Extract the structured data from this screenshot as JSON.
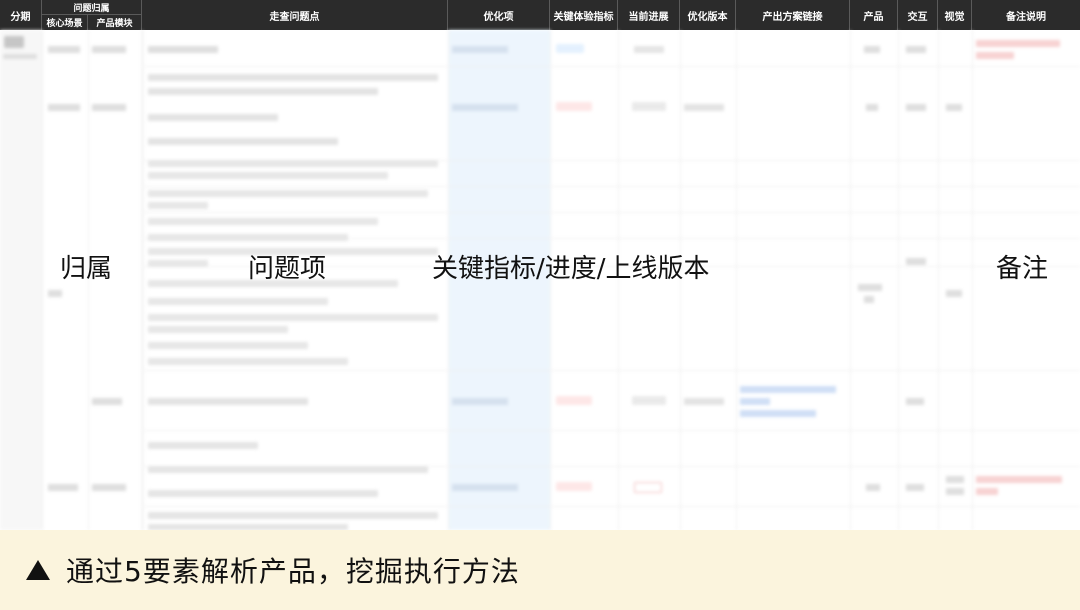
{
  "header": {
    "period": "分期",
    "group": "问题归属",
    "core_scene": "核心场景",
    "product_module": "产品模块",
    "issue_point": "走查问题点",
    "optimization": "优化项",
    "key_metric": "关键体验指标",
    "progress": "当前进展",
    "version": "优化版本",
    "solution_link": "产出方案链接",
    "product": "产品",
    "interaction": "交互",
    "visual": "视觉",
    "remarks": "备注说明"
  },
  "overlay": {
    "ownership": "归属",
    "issue_item": "问题项",
    "metrics": "关键指标/进度/上线版本",
    "remarks": "备注"
  },
  "caption": {
    "text": "通过5要素解析产品，挖掘执行方法"
  },
  "colors": {
    "header_bg": "#2b2b2b",
    "caption_bg": "#fbf4dd",
    "highlight_col": "#eaf4fd",
    "chip_pink": "#fde3e3"
  },
  "icons": {
    "caption_marker": "triangle-up-icon"
  }
}
